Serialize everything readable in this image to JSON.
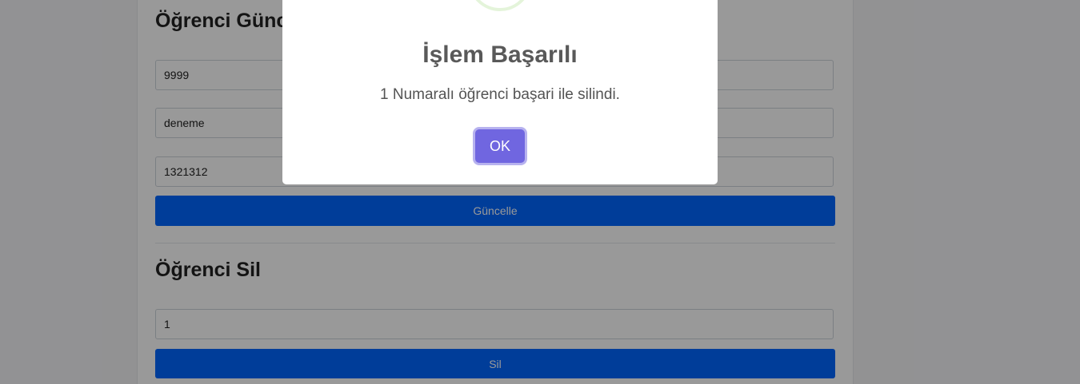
{
  "update_section": {
    "title": "Öğrenci Güncelle",
    "fields": [
      {
        "value": "9999"
      },
      {
        "value": "deneme"
      },
      {
        "value": "1321312"
      }
    ],
    "button_label": "Güncelle"
  },
  "delete_section": {
    "title": "Öğrenci Sil",
    "field_value": "1",
    "button_label": "Sil"
  },
  "modal": {
    "title": "İşlem Başarılı",
    "message": "1 Numaralı öğrenci başari ile silindi.",
    "ok_label": "OK",
    "icon": "success-check-icon"
  },
  "colors": {
    "primary_button": "#0066ff",
    "ok_button": "#7066e0",
    "success_ring": "#a5dc86"
  }
}
